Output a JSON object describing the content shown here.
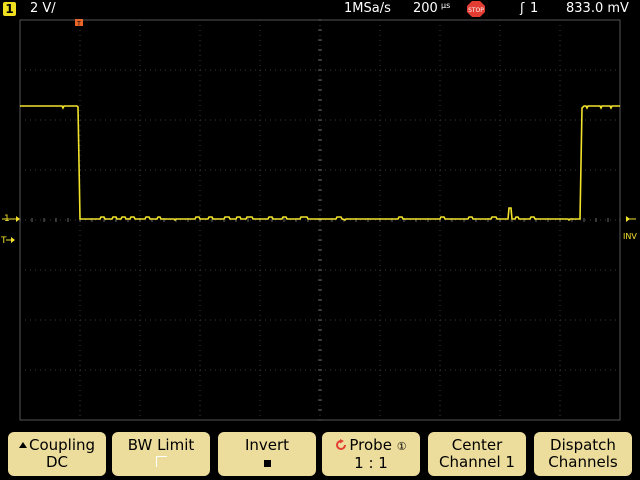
{
  "status": {
    "channel": "1",
    "scale": "2 V/",
    "sample_rate": "1MSa/s",
    "timebase": "200",
    "timebase_unit": "µs",
    "run_state": "STOP",
    "trigger_source": "1",
    "trigger_level": "833.0 mV"
  },
  "markers": {
    "channel_marker": "1",
    "invert_label": "INV"
  },
  "softkeys": [
    {
      "label": "Coupling",
      "value": "DC"
    },
    {
      "label": "BW Limit",
      "value": ""
    },
    {
      "label": "Invert",
      "value": ""
    },
    {
      "label": "Probe",
      "value": "1 : 1"
    },
    {
      "label": "Center",
      "value": "Channel 1"
    },
    {
      "label": "Dispatch",
      "value": "Channels"
    }
  ],
  "colors": {
    "trace": "#f2e22a",
    "softkey": "#ecdd9c",
    "trigger_marker": "#e8662a",
    "stop": "#e33d33"
  }
}
